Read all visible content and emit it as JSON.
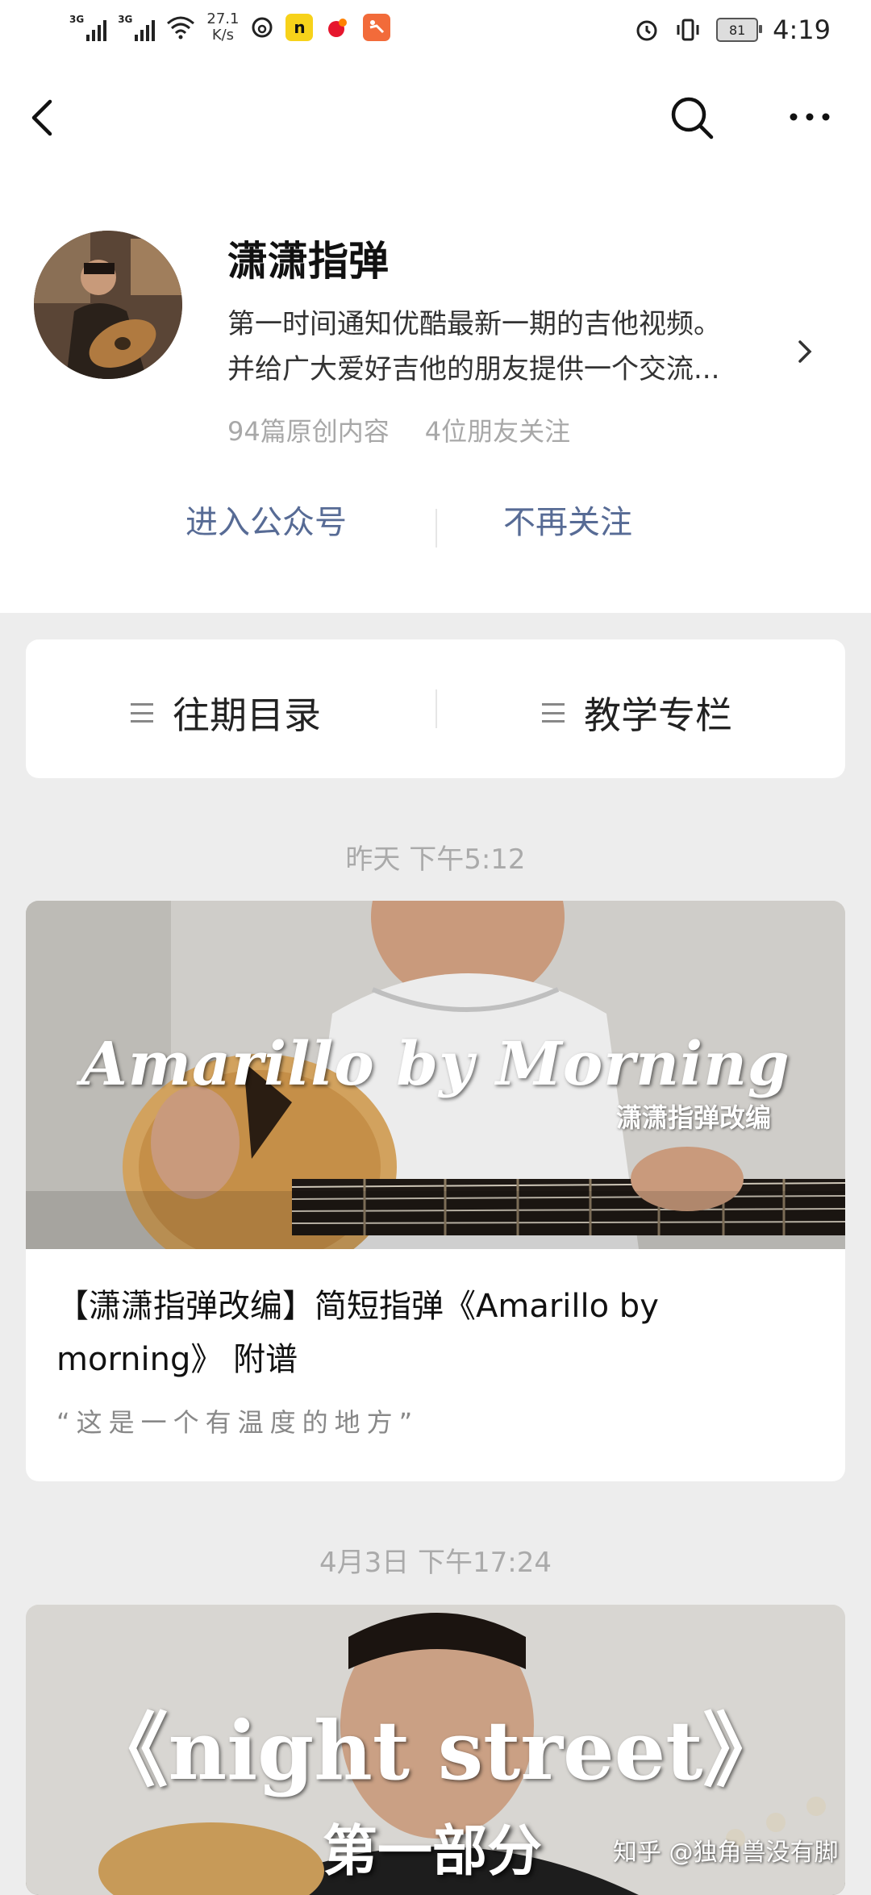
{
  "status_bar": {
    "network1": "3G",
    "network2": "3G",
    "speed_value": "27.1",
    "speed_unit": "K/s",
    "battery": "81",
    "time": "4:19"
  },
  "profile": {
    "name": "潇潇指弹",
    "desc_line1": "第一时间通知优酷最新一期的吉他视频。",
    "desc_line2": "并给广大爱好吉他的朋友提供一个交流...",
    "original_count": "94篇原创内容",
    "friends_following": "4位朋友关注",
    "enter_label": "进入公众号",
    "unfollow_label": "不再关注"
  },
  "menu": {
    "items": [
      {
        "label": "往期目录",
        "icon": "list-icon"
      },
      {
        "label": "教学专栏",
        "icon": "list-icon"
      }
    ]
  },
  "feed": [
    {
      "time": "昨天 下午5:12",
      "cover_title": "Amarillo by Morning",
      "cover_subtitle": "潇潇指弹改编",
      "title": "【潇潇指弹改编】简短指弹《Amarillo by morning》 附谱",
      "digest": "“这是一个有温度的地方”"
    },
    {
      "time": "4月3日 下午17:24",
      "cover_title": "《night street》",
      "cover_subtitle": "第一部分"
    }
  ],
  "watermark": "知乎 @独角兽没有脚"
}
